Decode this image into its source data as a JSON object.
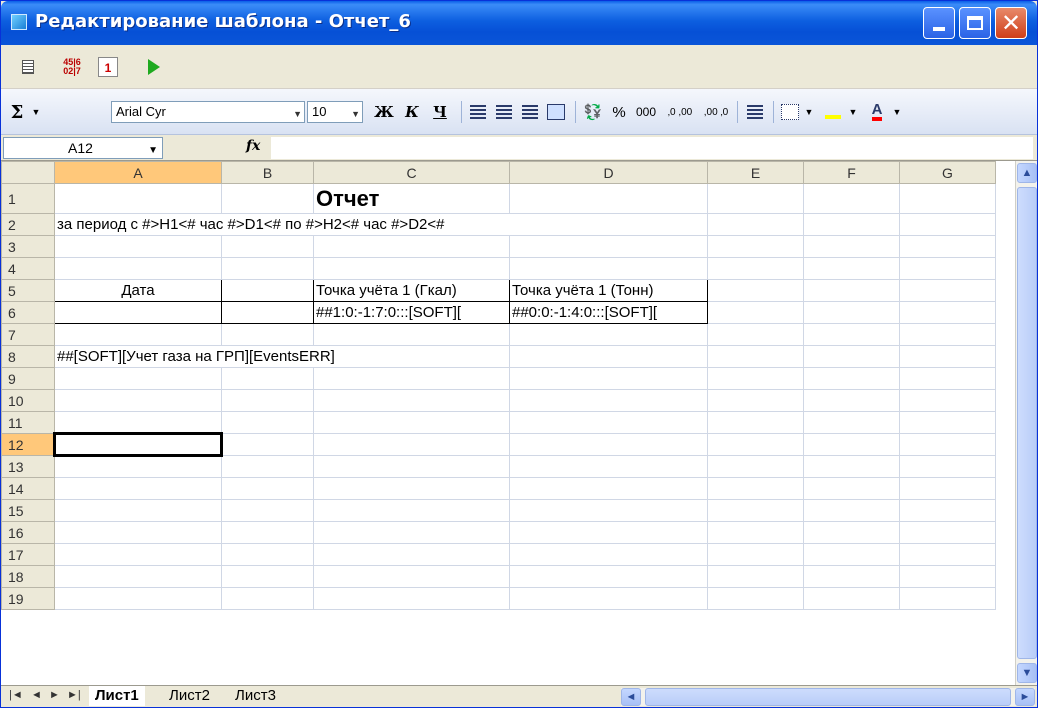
{
  "window": {
    "title": "Редактирование шаблона - Отчет_6",
    "close_glyph": "✕"
  },
  "toolbar1": {
    "number_icon_text": "45|6 02|7",
    "calendar_icon_text": "1"
  },
  "toolbar2": {
    "autosum": "Σ",
    "font_name": "Arial Cyr",
    "font_size": "10",
    "bold": "Ж",
    "italic": "К",
    "underline": "Ч",
    "percent": "%",
    "thousands": "000",
    "inc_decimal": "‚0 ,00",
    "dec_decimal": ",00 ‚0",
    "font_color_letter": "A"
  },
  "formula_bar": {
    "name_box": "A12",
    "fx_label": "fx",
    "formula": ""
  },
  "columns": [
    "A",
    "B",
    "C",
    "D",
    "E",
    "F",
    "G"
  ],
  "rows": [
    "1",
    "2",
    "3",
    "4",
    "5",
    "6",
    "7",
    "8",
    "9",
    "10",
    "11",
    "12",
    "13",
    "14",
    "15",
    "16",
    "17",
    "18",
    "19"
  ],
  "cells": {
    "C1": "Отчет",
    "A2": "за период с #>H1<# час #>D1<# по #>H2<# час #>D2<#",
    "A5": "Дата",
    "C5": "Точка учёта 1 (Гкал)",
    "D5": "Точка учёта 1 (Тонн)",
    "C6": "##1:0:-1:7:0:::[SOFT][",
    "D6": "##0:0:-1:4:0:::[SOFT][",
    "A8": "##[SOFT][Учет газа на ГРП][EventsERR]"
  },
  "sheet_tabs": [
    "Лист1",
    "Лист2",
    "Лист3"
  ],
  "active_sheet": "Лист1",
  "colors": {
    "titlebar": "#0a55d8",
    "selected_header": "#ffc87a",
    "grid_line": "#d0d7e5"
  }
}
